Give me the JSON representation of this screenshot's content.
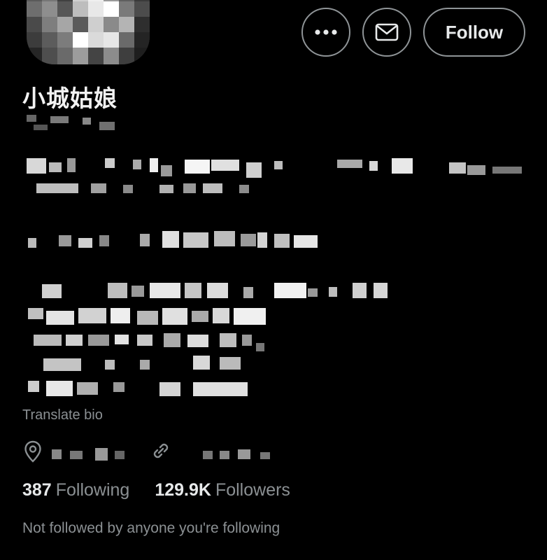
{
  "header": {
    "avatar_icon": "pixelated-avatar",
    "more_icon": "more-horizontal-icon",
    "message_icon": "envelope-icon",
    "follow_label": "Follow"
  },
  "profile": {
    "display_name": "小城姑娘",
    "translate_label": "Translate bio"
  },
  "meta": {
    "location_icon": "location-pin-icon",
    "link_icon": "link-icon"
  },
  "stats": {
    "following_count": "387",
    "following_label": "Following",
    "followers_count": "129.9K",
    "followers_label": "Followers"
  },
  "social_context": "Not followed by anyone you're following",
  "colors": {
    "background": "#000000",
    "primary_text": "#e7e9ea",
    "secondary_text": "#8b9093",
    "button_border": "#8f9497"
  }
}
